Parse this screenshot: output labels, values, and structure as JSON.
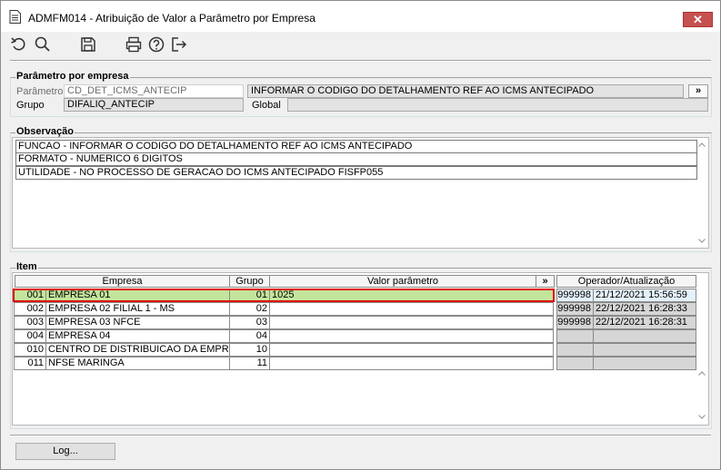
{
  "window": {
    "title": "ADMFM014 - Atribuição de Valor a Parâmetro por Empresa",
    "close_label": "✕"
  },
  "toolbar": {
    "icons": [
      "undo-icon",
      "search-icon",
      "save-icon",
      "print-icon",
      "help-icon",
      "exit-icon"
    ]
  },
  "param_group": {
    "title": "Parâmetro por empresa",
    "param_label": "Parâmetro",
    "param_value": "CD_DET_ICMS_ANTECIP",
    "param_desc": "INFORMAR O CODIGO DO DETALHAMENTO REF AO ICMS ANTECIPADO",
    "expand_label": "»",
    "group_label": "Grupo",
    "group_value": "DIFALIQ_ANTECIP",
    "global_label": "Global",
    "global_value": ""
  },
  "obs_group": {
    "title": "Observação",
    "lines": [
      "FUNCAO - INFORMAR O CODIGO DO DETALHAMENTO REF AO ICMS ANTECIPADO",
      "FORMATO - NUMERICO 6 DIGITOS",
      "UTILIDADE - NO PROCESSO DE GERACAO DO ICMS ANTECIPADO FISFP055"
    ]
  },
  "item_group": {
    "title": "Item",
    "headers": {
      "empresa": "Empresa",
      "grupo": "Grupo",
      "valor": "Valor parâmetro",
      "expand": "»",
      "operador": "Operador/Atualização"
    },
    "rows": [
      {
        "code": "001",
        "name": "EMPRESA 01",
        "grupo": "01",
        "valor": "1025",
        "operador": "999998",
        "data": "21/12/2021 15:56:59"
      },
      {
        "code": "002",
        "name": "EMPRESA 02 FILIAL 1 - MS",
        "grupo": "02",
        "valor": "",
        "operador": "999998",
        "data": "22/12/2021 16:28:33"
      },
      {
        "code": "003",
        "name": "EMPRESA 03 NFCE",
        "grupo": "03",
        "valor": "",
        "operador": "999998",
        "data": "22/12/2021 16:28:31"
      },
      {
        "code": "004",
        "name": "EMPRESA 04",
        "grupo": "04",
        "valor": "",
        "operador": "",
        "data": ""
      },
      {
        "code": "010",
        "name": "CENTRO DE DISTRIBUICAO DA EMPRESA",
        "grupo": "10",
        "valor": "",
        "operador": "",
        "data": ""
      },
      {
        "code": "011",
        "name": "NFSE MARINGA",
        "grupo": "11",
        "valor": "",
        "operador": "",
        "data": ""
      }
    ]
  },
  "footer": {
    "log_label": "Log..."
  },
  "colors": {
    "selected_row": "#c3e59b",
    "highlight_outline": "#e00000",
    "close_button": "#c75050"
  }
}
